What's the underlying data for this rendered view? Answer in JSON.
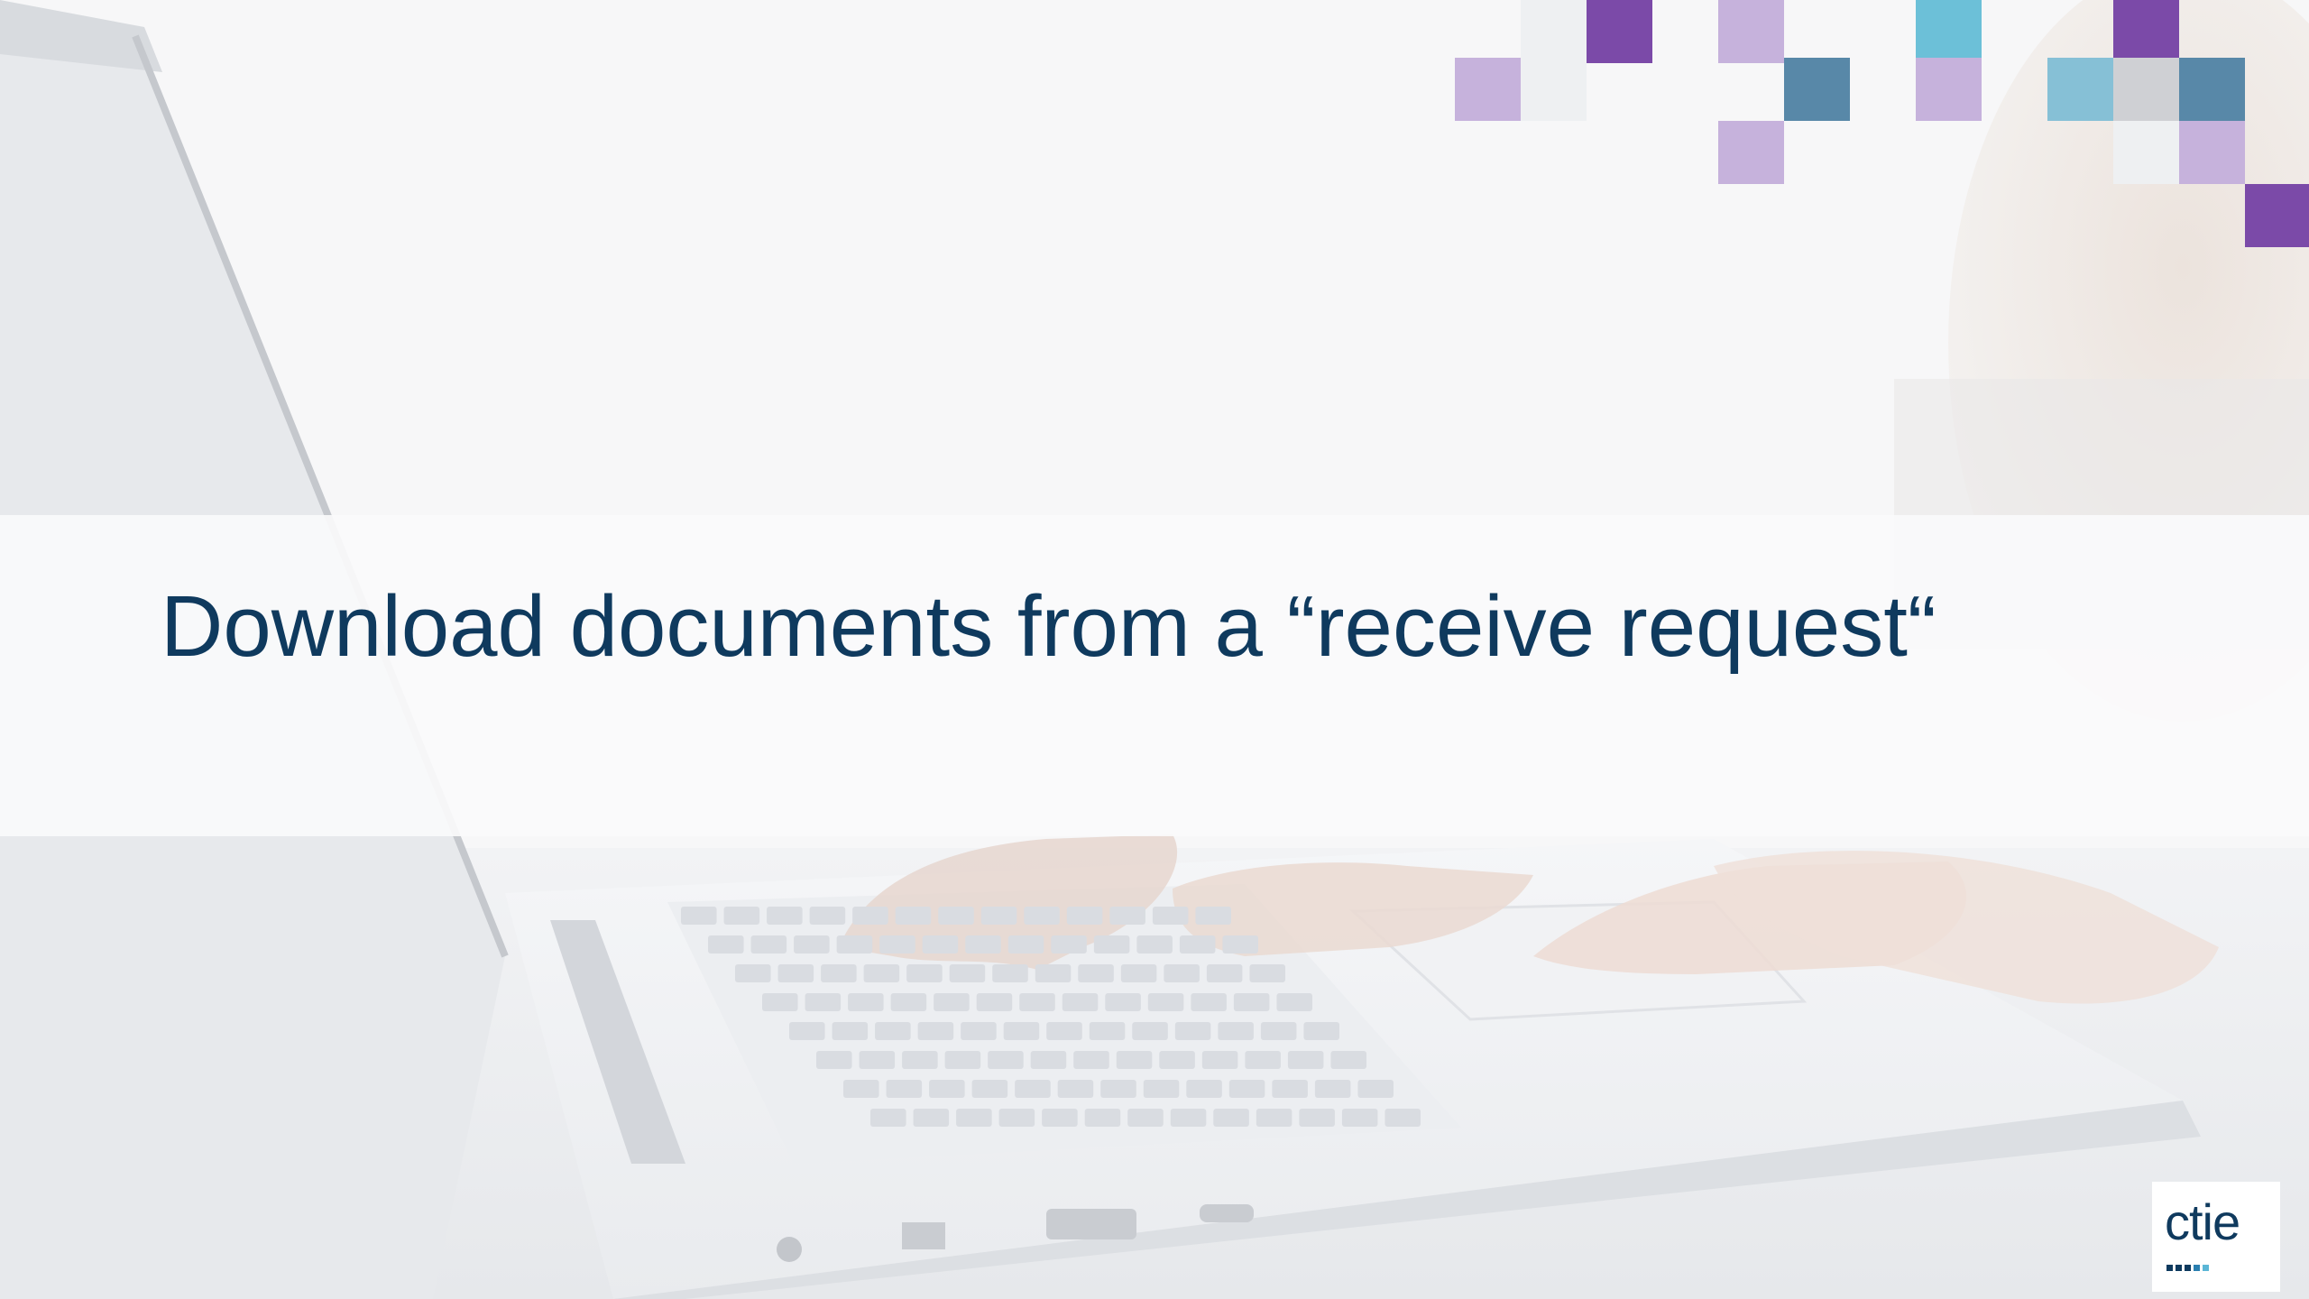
{
  "slide": {
    "title": "Download documents from a “receive request“"
  },
  "logo": {
    "text": "ctie",
    "icon": "ctie-logo",
    "dot_colors": [
      "#0f3a5e",
      "#0f3a5e",
      "#0f3a5e",
      "#2a7fb0",
      "#5bb6d6"
    ]
  },
  "background": {
    "icon": "laptop-typing-photo"
  },
  "colors": {
    "title": "#0f3a5e",
    "band": "#fafafb",
    "purple_dark": "#7b4aa8",
    "purple_light": "#c6b2dc",
    "teal": "#6cc0d8",
    "steel_blue": "#5888a8",
    "light_blue": "#86c0d6",
    "grey": "#cfd0d4",
    "pale": "#eef0f2"
  }
}
